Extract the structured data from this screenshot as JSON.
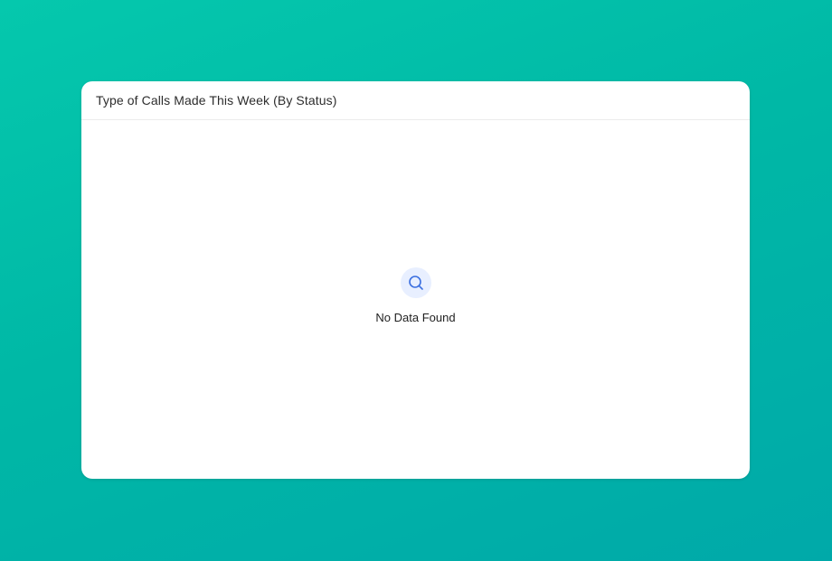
{
  "widget": {
    "title": "Type of Calls Made This Week (By Status)",
    "empty_state": {
      "icon": "search-icon",
      "message": "No Data Found"
    }
  },
  "colors": {
    "background_gradient_start": "#05c8ad",
    "background_gradient_end": "#00a9a9",
    "icon_accent": "#3b6fe0",
    "icon_bg": "#e8efff"
  }
}
